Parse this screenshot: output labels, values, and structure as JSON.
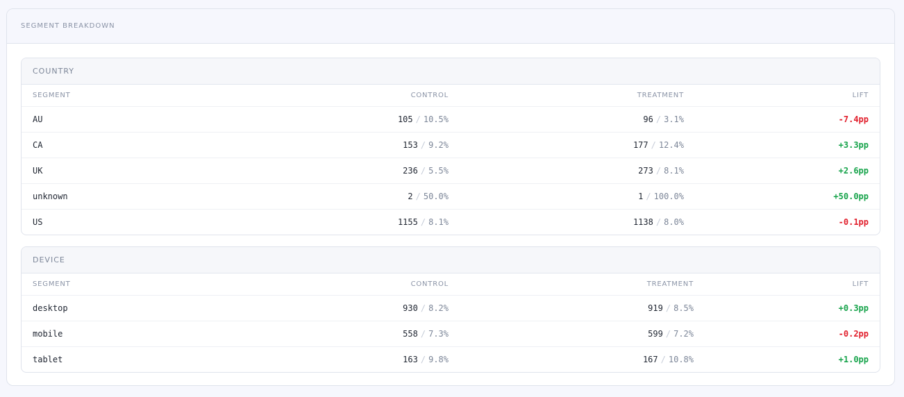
{
  "panel": {
    "title": "SEGMENT BREAKDOWN"
  },
  "colors": {
    "positive": "#16a34a",
    "negative": "#e11d2a"
  },
  "groups": [
    {
      "title": "COUNTRY",
      "headers": {
        "segment": "SEGMENT",
        "control": "CONTROL",
        "treatment": "TREATMENT",
        "lift": "LIFT"
      },
      "rows": [
        {
          "segment": "AU",
          "control_count": "105",
          "control_pct": "10.5%",
          "treatment_count": "96",
          "treatment_pct": "3.1%",
          "lift": "-7.4pp",
          "dir": "neg"
        },
        {
          "segment": "CA",
          "control_count": "153",
          "control_pct": "9.2%",
          "treatment_count": "177",
          "treatment_pct": "12.4%",
          "lift": "+3.3pp",
          "dir": "pos"
        },
        {
          "segment": "UK",
          "control_count": "236",
          "control_pct": "5.5%",
          "treatment_count": "273",
          "treatment_pct": "8.1%",
          "lift": "+2.6pp",
          "dir": "pos"
        },
        {
          "segment": "unknown",
          "control_count": "2",
          "control_pct": "50.0%",
          "treatment_count": "1",
          "treatment_pct": "100.0%",
          "lift": "+50.0pp",
          "dir": "pos"
        },
        {
          "segment": "US",
          "control_count": "1155",
          "control_pct": "8.1%",
          "treatment_count": "1138",
          "treatment_pct": "8.0%",
          "lift": "-0.1pp",
          "dir": "neg"
        }
      ]
    },
    {
      "title": "DEVICE",
      "headers": {
        "segment": "SEGMENT",
        "control": "CONTROL",
        "treatment": "TREATMENT",
        "lift": "LIFT"
      },
      "rows": [
        {
          "segment": "desktop",
          "control_count": "930",
          "control_pct": "8.2%",
          "treatment_count": "919",
          "treatment_pct": "8.5%",
          "lift": "+0.3pp",
          "dir": "pos"
        },
        {
          "segment": "mobile",
          "control_count": "558",
          "control_pct": "7.3%",
          "treatment_count": "599",
          "treatment_pct": "7.2%",
          "lift": "-0.2pp",
          "dir": "neg"
        },
        {
          "segment": "tablet",
          "control_count": "163",
          "control_pct": "9.8%",
          "treatment_count": "167",
          "treatment_pct": "10.8%",
          "lift": "+1.0pp",
          "dir": "pos"
        }
      ]
    }
  ]
}
